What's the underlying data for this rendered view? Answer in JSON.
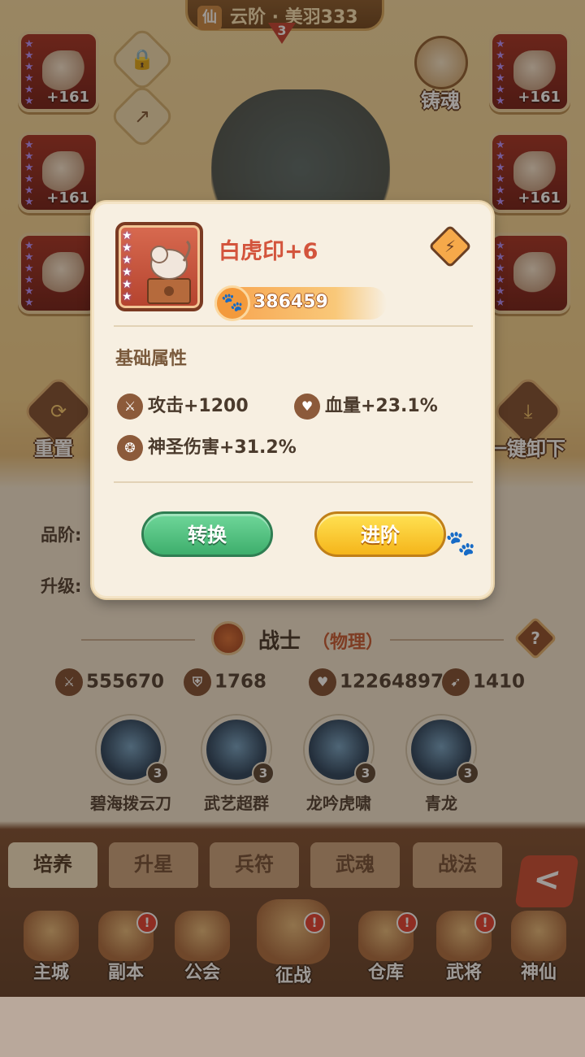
{
  "background": {
    "top_banner": "云阶 · 美羽333",
    "rank_number": "3",
    "slots": [
      {
        "level": "+161",
        "stars": 6
      },
      {
        "level": "+161",
        "stars": 6
      },
      {
        "level": "",
        "stars": 6
      },
      {
        "level": "+161",
        "stars": 6
      },
      {
        "level": "+161",
        "stars": 6
      },
      {
        "level": "",
        "stars": 6
      }
    ],
    "forge_label": "铸魂",
    "reset_label": "重置",
    "unequip_all_label": "一键卸下",
    "grade_label": "品阶:",
    "upgrade_label": "升级:",
    "hero_class": "战士",
    "hero_damage_type": "（物理）",
    "help_symbol": "?",
    "stats": {
      "attack": "555670",
      "defense": "1768",
      "hp": "12264897",
      "speed": "1410"
    },
    "skills": [
      {
        "name": "碧海拨云刀",
        "count": "3"
      },
      {
        "name": "武艺超群",
        "count": "3"
      },
      {
        "name": "龙吟虎啸",
        "count": "3"
      },
      {
        "name": "青龙",
        "count": "3"
      }
    ],
    "tabs": [
      "培养",
      "升星",
      "兵符",
      "武魂",
      "战法"
    ],
    "back_symbol": "<",
    "nav": [
      {
        "label": "主城",
        "alert": false
      },
      {
        "label": "副本",
        "alert": true
      },
      {
        "label": "公会",
        "alert": false
      },
      {
        "label": "征战",
        "alert": true
      },
      {
        "label": "仓库",
        "alert": true
      },
      {
        "label": "武将",
        "alert": true
      },
      {
        "label": "神仙",
        "alert": false
      }
    ],
    "alert_symbol": "!"
  },
  "popup": {
    "item_name": "白虎印+6",
    "item_stars": 6,
    "power": "386459",
    "section_title": "基础属性",
    "attributes": {
      "attack": "攻击+1200",
      "hp": "血量+23.1%",
      "holy_damage": "神圣伤害+31.2%"
    },
    "convert_button": "转换",
    "advance_button": "进阶"
  },
  "icons": {
    "convert": "swap-icon",
    "power": "paw-icon",
    "attack": "sword-icon",
    "hp": "heart-icon",
    "holy": "holy-swirl-icon",
    "lock": "lock-icon",
    "share": "share-icon"
  },
  "colors": {
    "item_name": "#d3543c",
    "green_button": "#3eae6c",
    "yellow_button": "#f5b51b",
    "popup_bg": "#f7efe1"
  }
}
